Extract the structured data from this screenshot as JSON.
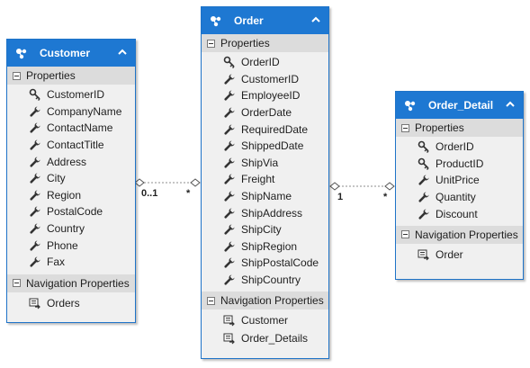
{
  "entities": {
    "customer": {
      "title": "Customer",
      "properties_label": "Properties",
      "properties": [
        {
          "name": "CustomerID",
          "icon": "key-icon"
        },
        {
          "name": "CompanyName",
          "icon": "wrench-icon"
        },
        {
          "name": "ContactName",
          "icon": "wrench-icon"
        },
        {
          "name": "ContactTitle",
          "icon": "wrench-icon"
        },
        {
          "name": "Address",
          "icon": "wrench-icon"
        },
        {
          "name": "City",
          "icon": "wrench-icon"
        },
        {
          "name": "Region",
          "icon": "wrench-icon"
        },
        {
          "name": "PostalCode",
          "icon": "wrench-icon"
        },
        {
          "name": "Country",
          "icon": "wrench-icon"
        },
        {
          "name": "Phone",
          "icon": "wrench-icon"
        },
        {
          "name": "Fax",
          "icon": "wrench-icon"
        }
      ],
      "nav_label": "Navigation Properties",
      "nav": [
        {
          "name": "Orders",
          "icon": "navigation-icon"
        }
      ]
    },
    "order": {
      "title": "Order",
      "properties_label": "Properties",
      "properties": [
        {
          "name": "OrderID",
          "icon": "key-icon"
        },
        {
          "name": "CustomerID",
          "icon": "wrench-icon"
        },
        {
          "name": "EmployeeID",
          "icon": "wrench-icon"
        },
        {
          "name": "OrderDate",
          "icon": "wrench-icon"
        },
        {
          "name": "RequiredDate",
          "icon": "wrench-icon"
        },
        {
          "name": "ShippedDate",
          "icon": "wrench-icon"
        },
        {
          "name": "ShipVia",
          "icon": "wrench-icon"
        },
        {
          "name": "Freight",
          "icon": "wrench-icon"
        },
        {
          "name": "ShipName",
          "icon": "wrench-icon"
        },
        {
          "name": "ShipAddress",
          "icon": "wrench-icon"
        },
        {
          "name": "ShipCity",
          "icon": "wrench-icon"
        },
        {
          "name": "ShipRegion",
          "icon": "wrench-icon"
        },
        {
          "name": "ShipPostalCode",
          "icon": "wrench-icon"
        },
        {
          "name": "ShipCountry",
          "icon": "wrench-icon"
        }
      ],
      "nav_label": "Navigation Properties",
      "nav": [
        {
          "name": "Customer",
          "icon": "navigation-icon"
        },
        {
          "name": "Order_Details",
          "icon": "navigation-icon"
        }
      ]
    },
    "order_detail": {
      "title": "Order_Detail",
      "properties_label": "Properties",
      "properties": [
        {
          "name": "OrderID",
          "icon": "key-icon"
        },
        {
          "name": "ProductID",
          "icon": "key-icon"
        },
        {
          "name": "UnitPrice",
          "icon": "wrench-icon"
        },
        {
          "name": "Quantity",
          "icon": "wrench-icon"
        },
        {
          "name": "Discount",
          "icon": "wrench-icon"
        }
      ],
      "nav_label": "Navigation Properties",
      "nav": [
        {
          "name": "Order",
          "icon": "navigation-icon"
        }
      ]
    }
  },
  "associations": [
    {
      "from": "customer",
      "to": "order",
      "from_mult": "0..1",
      "to_mult": "*"
    },
    {
      "from": "order",
      "to": "order_detail",
      "from_mult": "1",
      "to_mult": "*"
    }
  ],
  "colors": {
    "header": "#1e78d2",
    "border": "#1e73c8",
    "body": "#f0f0f0",
    "section": "#dcdcdc",
    "connector": "#8c8c8c"
  }
}
